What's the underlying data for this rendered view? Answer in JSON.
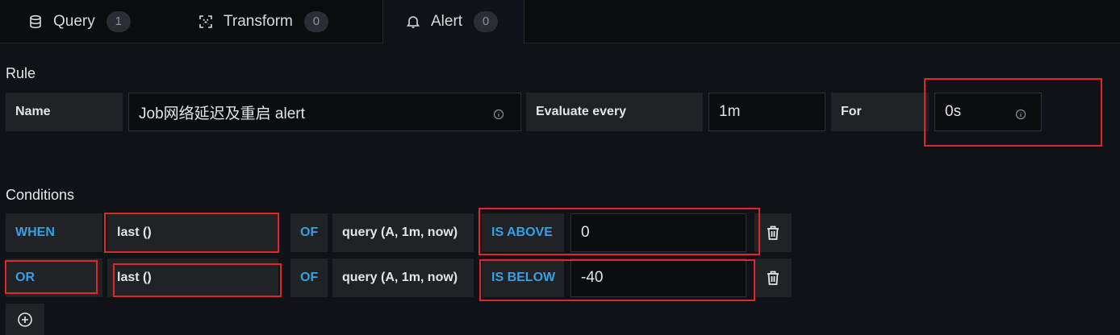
{
  "tabs": [
    {
      "label": "Query",
      "count": "1",
      "icon": "database-icon"
    },
    {
      "label": "Transform",
      "count": "0",
      "icon": "transform-icon"
    },
    {
      "label": "Alert",
      "count": "0",
      "icon": "bell-icon"
    }
  ],
  "rule": {
    "title": "Rule",
    "name_label": "Name",
    "name_value": "Job网络延迟及重启 alert",
    "evaluate_label": "Evaluate every",
    "evaluate_value": "1m",
    "for_label": "For",
    "for_value": "0s"
  },
  "conditions": {
    "title": "Conditions",
    "rows": [
      {
        "operator": "WHEN",
        "func": "last ()",
        "of": "OF",
        "query": "query (A, 1m, now)",
        "evaluator": "IS ABOVE",
        "value": "0"
      },
      {
        "operator": "OR",
        "func": "last ()",
        "of": "OF",
        "query": "query (A, 1m, now)",
        "evaluator": "IS BELOW",
        "value": "-40"
      }
    ]
  },
  "colors": {
    "accent": "#33a2e5",
    "highlight": "#e3242b",
    "background": "#111217"
  }
}
